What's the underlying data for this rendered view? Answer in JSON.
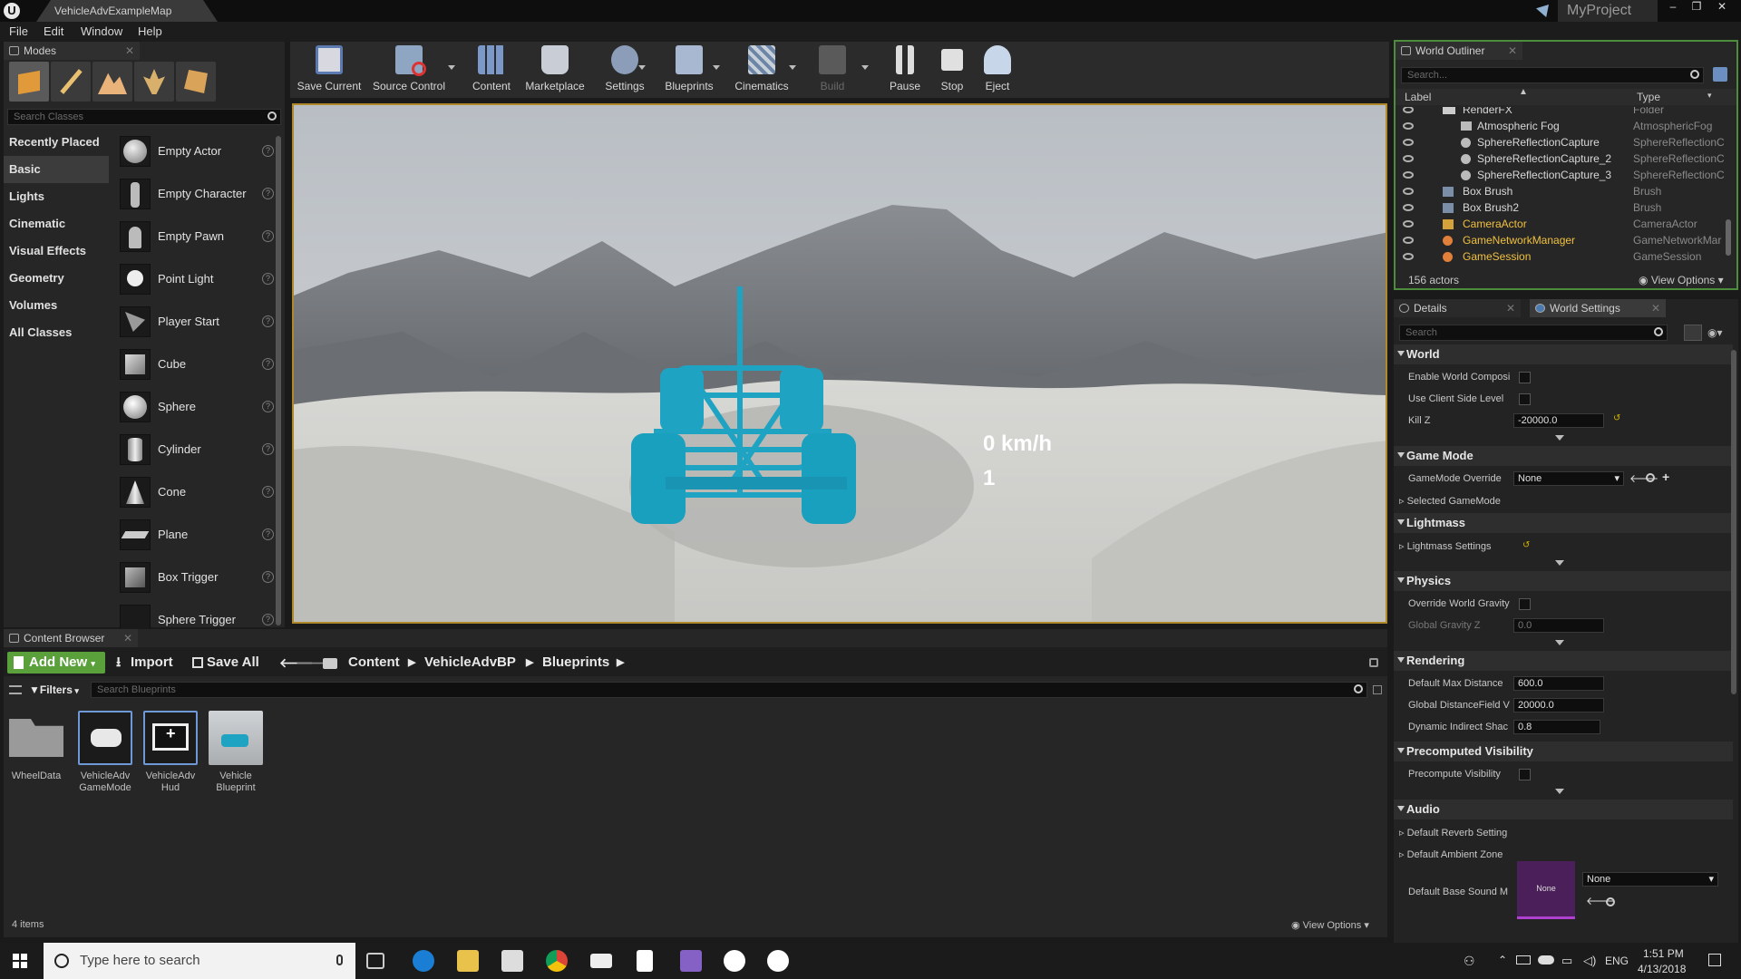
{
  "window": {
    "doc_tab": "VehicleAdvExampleMap",
    "project": "MyProject"
  },
  "menu": [
    "File",
    "Edit",
    "Window",
    "Help"
  ],
  "modes": {
    "tab": "Modes",
    "search_placeholder": "Search Classes",
    "categories": [
      "Recently Placed",
      "Basic",
      "Lights",
      "Cinematic",
      "Visual Effects",
      "Geometry",
      "Volumes",
      "All Classes"
    ],
    "active_category": "Basic",
    "items": [
      "Empty Actor",
      "Empty Character",
      "Empty Pawn",
      "Point Light",
      "Player Start",
      "Cube",
      "Sphere",
      "Cylinder",
      "Cone",
      "Plane",
      "Box Trigger",
      "Sphere Trigger"
    ]
  },
  "toolbar": {
    "buttons": [
      "Save Current",
      "Source Control",
      "Content",
      "Marketplace",
      "Settings",
      "Blueprints",
      "Cinematics",
      "Build",
      "Pause",
      "Stop",
      "Eject"
    ]
  },
  "viewport": {
    "speed": "0 km/h",
    "gear": "1"
  },
  "content_browser": {
    "tab": "Content Browser",
    "add_new": "Add New",
    "import": "Import",
    "save_all": "Save All",
    "breadcrumb": [
      "Content",
      "VehicleAdvBP",
      "Blueprints"
    ],
    "filters": "Filters",
    "search_placeholder": "Search Blueprints",
    "assets": [
      {
        "line1": "WheelData",
        "line2": ""
      },
      {
        "line1": "VehicleAdv",
        "line2": "GameMode"
      },
      {
        "line1": "VehicleAdv",
        "line2": "Hud"
      },
      {
        "line1": "Vehicle",
        "line2": "Blueprint"
      }
    ],
    "count": "4 items",
    "view_options": "View Options"
  },
  "outliner": {
    "tab": "World Outliner",
    "search_placeholder": "Search...",
    "col_label": "Label",
    "col_type": "Type",
    "rows": [
      {
        "label": "RenderFX",
        "type": "Folder"
      },
      {
        "label": "Atmospheric Fog",
        "type": "AtmosphericFog"
      },
      {
        "label": "SphereReflectionCapture",
        "type": "SphereReflectionC"
      },
      {
        "label": "SphereReflectionCapture_2",
        "type": "SphereReflectionC"
      },
      {
        "label": "SphereReflectionCapture_3",
        "type": "SphereReflectionC"
      },
      {
        "label": "Box Brush",
        "type": "Brush"
      },
      {
        "label": "Box Brush2",
        "type": "Brush"
      },
      {
        "label": "CameraActor",
        "type": "CameraActor"
      },
      {
        "label": "GameNetworkManager",
        "type": "GameNetworkMar"
      },
      {
        "label": "GameSession",
        "type": "GameSession"
      }
    ],
    "count": "156 actors",
    "view_options": "View Options"
  },
  "details": {
    "tab_details": "Details",
    "tab_world": "World Settings",
    "search_placeholder": "Search",
    "sections": {
      "world": "World",
      "game_mode": "Game Mode",
      "lightmass": "Lightmass",
      "physics": "Physics",
      "rendering": "Rendering",
      "precomputed": "Precomputed Visibility",
      "audio": "Audio"
    },
    "props": {
      "enable_world_comp": "Enable World Composi",
      "use_client_side": "Use Client Side Level",
      "kill_z": "Kill Z",
      "kill_z_val": "-20000.0",
      "gm_override": "GameMode Override",
      "gm_override_val": "None",
      "selected_gm": "Selected GameMode",
      "lightmass_settings": "Lightmass Settings",
      "override_gravity": "Override World Gravity",
      "global_gravity": "Global Gravity Z",
      "global_gravity_val": "0.0",
      "default_max_dist": "Default Max Distance",
      "default_max_dist_val": "600.0",
      "global_df": "Global DistanceField V",
      "global_df_val": "20000.0",
      "dyn_indirect": "Dynamic Indirect Shac",
      "dyn_indirect_val": "0.8",
      "precompute_vis": "Precompute Visibility",
      "reverb": "Default Reverb Setting",
      "ambient": "Default Ambient Zone",
      "base_sound": "Default Base Sound M",
      "base_sound_val": "None",
      "base_sound_thumb": "None"
    }
  },
  "taskbar": {
    "search": "Type here to search",
    "lang": "ENG",
    "time": "1:51 PM",
    "date": "4/13/2018"
  },
  "colors": {
    "accent_green": "#5aa13c",
    "vehicle": "#1fa3c2",
    "viewport_border": "#b08a2a"
  }
}
